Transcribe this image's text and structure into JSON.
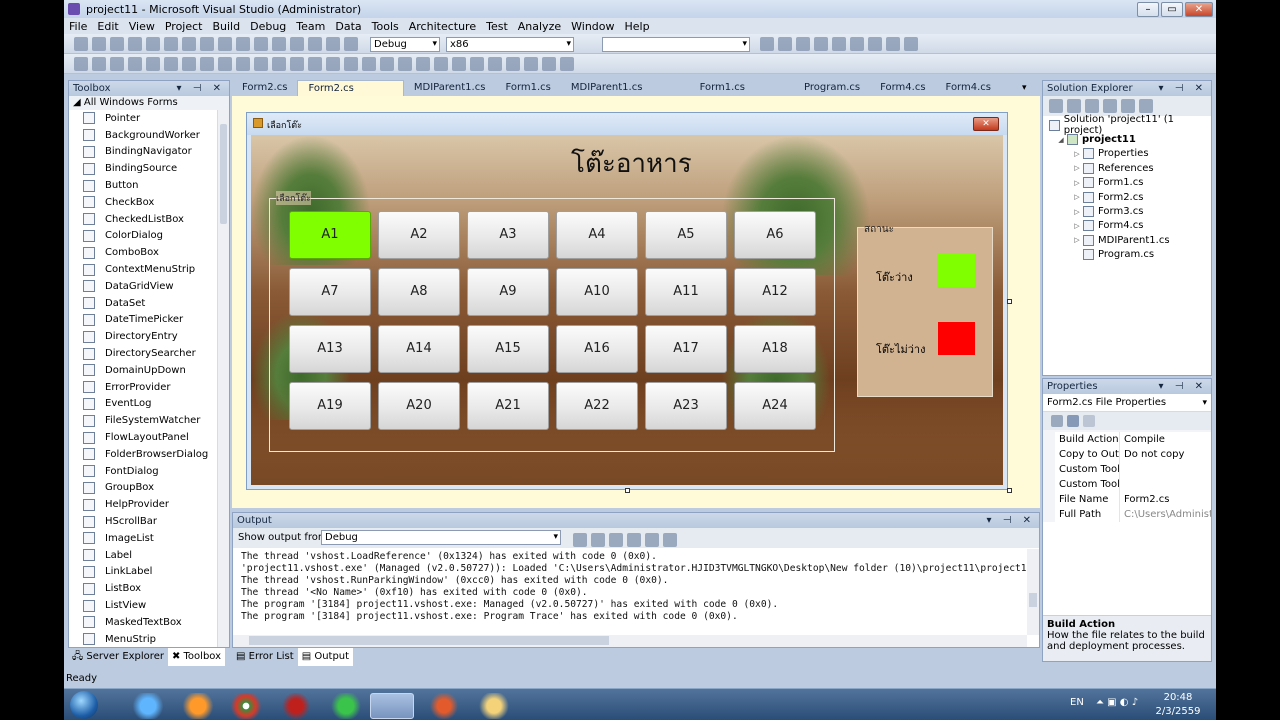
{
  "window": {
    "title": "project11 - Microsoft Visual Studio (Administrator)"
  },
  "menu": [
    "File",
    "Edit",
    "View",
    "Project",
    "Build",
    "Debug",
    "Team",
    "Data",
    "Tools",
    "Architecture",
    "Test",
    "Analyze",
    "Window",
    "Help"
  ],
  "toolbar": {
    "config": "Debug",
    "platform": "x86",
    "search": ""
  },
  "toolbox": {
    "title": "Toolbox",
    "group": "All Windows Forms",
    "items": [
      "Pointer",
      "BackgroundWorker",
      "BindingNavigator",
      "BindingSource",
      "Button",
      "CheckBox",
      "CheckedListBox",
      "ColorDialog",
      "ComboBox",
      "ContextMenuStrip",
      "DataGridView",
      "DataSet",
      "DateTimePicker",
      "DirectoryEntry",
      "DirectorySearcher",
      "DomainUpDown",
      "ErrorProvider",
      "EventLog",
      "FileSystemWatcher",
      "FlowLayoutPanel",
      "FolderBrowserDialog",
      "FontDialog",
      "GroupBox",
      "HelpProvider",
      "HScrollBar",
      "ImageList",
      "Label",
      "LinkLabel",
      "ListBox",
      "ListView",
      "MaskedTextBox",
      "MenuStrip"
    ],
    "tabs": [
      "Server Explorer",
      "Toolbox"
    ]
  },
  "doc_tabs": [
    "Form2.cs",
    "Form2.cs [Design]",
    "MDIParent1.cs",
    "Form1.cs",
    "MDIParent1.cs [Design]",
    "Form1.cs [Design]",
    "Program.cs",
    "Form4.cs",
    "Form4.cs [Design]"
  ],
  "form": {
    "caption": "เลือกโต๊ะ",
    "title": "โต๊ะอาหาร",
    "group_label": "เลือกโต๊ะ",
    "tables": [
      "A1",
      "A2",
      "A3",
      "A4",
      "A5",
      "A6",
      "A7",
      "A8",
      "A9",
      "A10",
      "A11",
      "A12",
      "A13",
      "A14",
      "A15",
      "A16",
      "A17",
      "A18",
      "A19",
      "A20",
      "A21",
      "A22",
      "A23",
      "A24"
    ],
    "free_tables": [
      "A1"
    ],
    "status": {
      "label": "สถานะ",
      "free_label": "โต๊ะว่าง",
      "busy_label": "โต๊ะไม่ว่าง",
      "free_color": "#7fff00",
      "busy_color": "#ff0000"
    }
  },
  "solution": {
    "title": "Solution Explorer",
    "solution": "Solution 'project11' (1 project)",
    "project": "project11",
    "items": [
      "Properties",
      "References",
      "Form1.cs",
      "Form2.cs",
      "Form3.cs",
      "Form4.cs",
      "MDIParent1.cs",
      "Program.cs"
    ]
  },
  "properties": {
    "title": "Properties",
    "object": "Form2.cs",
    "object_type": "File Properties",
    "rows": [
      [
        "Build Action",
        "Compile"
      ],
      [
        "Copy to Outpu",
        "Do not copy"
      ],
      [
        "Custom Tool",
        ""
      ],
      [
        "Custom Tool I",
        ""
      ],
      [
        "File Name",
        "Form2.cs"
      ],
      [
        "Full Path",
        "C:\\Users\\Administra"
      ]
    ],
    "desc_title": "Build Action",
    "desc_text": "How the file relates to the build and deployment processes."
  },
  "output": {
    "title": "Output",
    "show_from_label": "Show output from:",
    "source": "Debug",
    "lines": [
      "The thread 'vshost.LoadReference' (0x1324) has exited with code 0 (0x0).",
      "'project11.vshost.exe' (Managed (v2.0.50727)): Loaded 'C:\\Users\\Administrator.HJID3TVMGLTNGKO\\Desktop\\New folder (10)\\project11\\project11\\bi",
      "The thread 'vshost.RunParkingWindow' (0xcc0) has exited with code 0 (0x0).",
      "The thread '<No Name>' (0xf10) has exited with code 0 (0x0).",
      "The program '[3184] project11.vshost.exe: Managed (v2.0.50727)' has exited with code 0 (0x0).",
      "The program '[3184] project11.vshost.exe: Program Trace' has exited with code 0 (0x0)."
    ],
    "tabs": [
      "Error List",
      "Output"
    ]
  },
  "statusbar": {
    "text": "Ready"
  },
  "taskbar": {
    "lang": "EN",
    "time": "20:48",
    "date": "2/3/2559"
  }
}
